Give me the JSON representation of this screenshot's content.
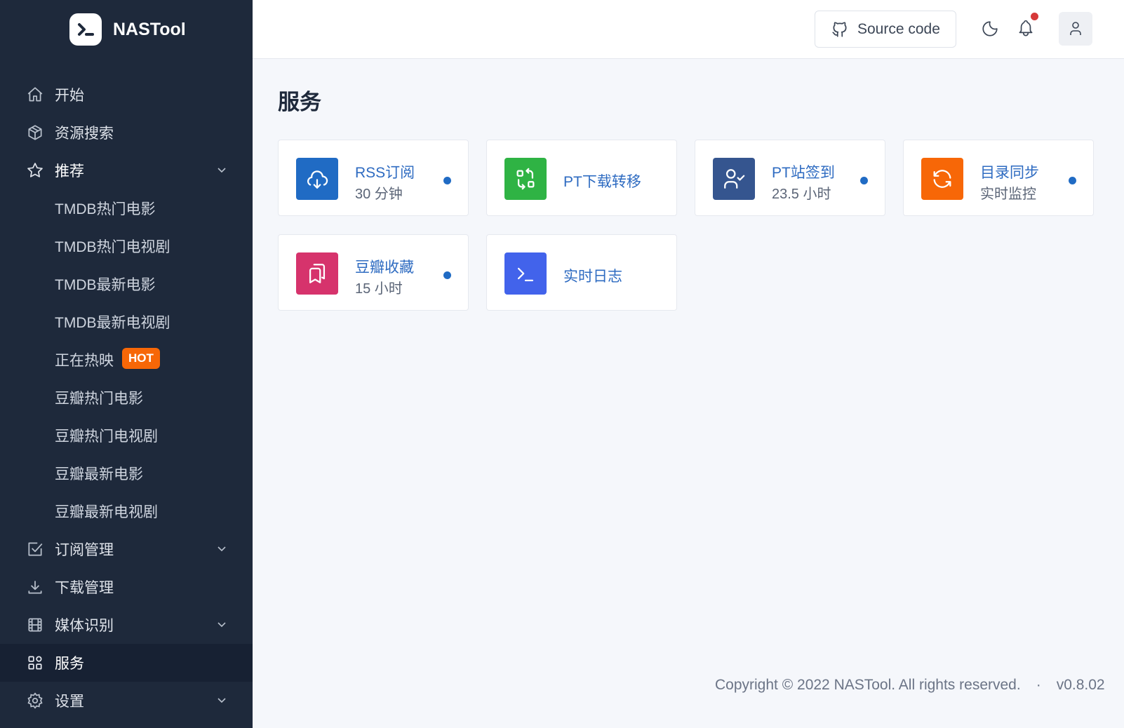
{
  "brand": {
    "name": "NASTool"
  },
  "nav": {
    "items": [
      {
        "label": "开始",
        "icon": "home-icon"
      },
      {
        "label": "资源搜索",
        "icon": "package-icon"
      },
      {
        "label": "推荐",
        "icon": "star-icon"
      },
      {
        "label": "TMDB热门电影"
      },
      {
        "label": "TMDB热门电视剧"
      },
      {
        "label": "TMDB最新电影"
      },
      {
        "label": "TMDB最新电视剧"
      },
      {
        "label": "正在热映",
        "badge": "HOT"
      },
      {
        "label": "豆瓣热门电影"
      },
      {
        "label": "豆瓣热门电视剧"
      },
      {
        "label": "豆瓣最新电影"
      },
      {
        "label": "豆瓣最新电视剧"
      },
      {
        "label": "订阅管理",
        "icon": "checkbox-icon"
      },
      {
        "label": "下载管理",
        "icon": "download-icon"
      },
      {
        "label": "媒体识别",
        "icon": "movie-icon"
      },
      {
        "label": "服务",
        "icon": "apps-icon"
      },
      {
        "label": "设置",
        "icon": "settings-icon"
      }
    ]
  },
  "header": {
    "source_code_label": "Source code"
  },
  "page": {
    "title": "服务"
  },
  "services": [
    {
      "title": "RSS订阅",
      "subtitle": "30 分钟",
      "color": "#206bc4",
      "icon": "cloud-download-icon",
      "running": true
    },
    {
      "title": "PT下载转移",
      "color": "#2fb344",
      "icon": "transfer-icon",
      "running": false
    },
    {
      "title": "PT站签到",
      "subtitle": "23.5 小时",
      "color": "#35558f",
      "icon": "user-check-icon",
      "running": true
    },
    {
      "title": "目录同步",
      "subtitle": "实时监控",
      "color": "#f76707",
      "icon": "refresh-icon",
      "running": true
    },
    {
      "title": "豆瓣收藏",
      "subtitle": "15 小时",
      "color": "#d6336c",
      "icon": "bookmarks-icon",
      "running": true
    },
    {
      "title": "实时日志",
      "color": "#4263eb",
      "icon": "terminal-icon",
      "running": false
    }
  ],
  "footer": {
    "copyright": "Copyright © 2022 NASTool. All rights reserved.",
    "separator": "·",
    "version": "v0.8.02"
  }
}
